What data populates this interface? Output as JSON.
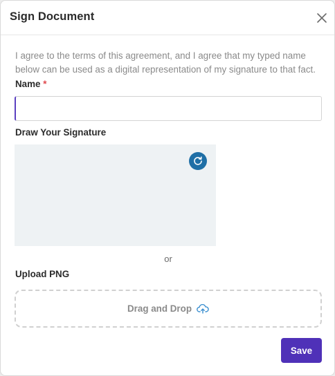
{
  "dialog": {
    "title": "Sign Document",
    "close_icon": "close-icon",
    "intro_text": "I agree to the terms of this agreement, and I agree that my typed name below can be used as a digital representation of my signature to that fact.",
    "name_label": "Name",
    "required_marker": "*",
    "name_value": "",
    "draw_label": "Draw Your Signature",
    "reset_icon": "refresh-icon",
    "or_text": "or",
    "upload_label": "Upload PNG",
    "drop_text": "Drag and Drop",
    "upload_icon": "cloud-upload-icon",
    "save_label": "Save"
  },
  "colors": {
    "accent": "#4f31b8",
    "input_focus": "#5a3fc0",
    "reset_button": "#1f6fa6",
    "signature_pad": "#eef2f4",
    "required": "#e0484d"
  }
}
